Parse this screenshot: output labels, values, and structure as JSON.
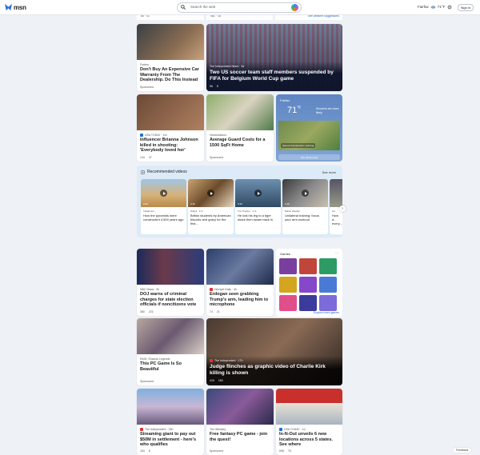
{
  "header": {
    "brand": "msn",
    "search_placeholder": "Search the web",
    "weather": {
      "location": "Fairfax",
      "temp": "71°F"
    },
    "signin_label": "Sign in",
    "feedback_label": "Feedback"
  },
  "top_strip": {
    "meta1": "80   ·   41",
    "meta2": "461   ·   18",
    "link": "See weather suggestions"
  },
  "cards": [
    {
      "id": "forbes",
      "source": "Forbes",
      "title": "Don't Buy An Expensive Car Warranty From The Dealership. Do This Instead",
      "sponsored": "Sponsored"
    },
    {
      "id": "soccer",
      "source": "The Independent News · 3d",
      "title": "Two US soccer team staff members suspended by FIFA for Belgium World Cup game",
      "likes": "96",
      "comments": "8"
    },
    {
      "id": "brianna",
      "source": "USA TODAY · 1hr",
      "title": "Influencer Brianna Johnson killed in shooting: 'Everybody loved her'",
      "likes": "144",
      "comments": "37"
    },
    {
      "id": "guard",
      "source": "HomeAdvisor",
      "title": "Average Guard Costs for a 1500 SqFt Home",
      "sponsored": "Sponsored"
    },
    {
      "id": "doj",
      "source": "NBC News · 9h",
      "title": "DOJ warns of criminal charges for state election officials if noncitizens vote",
      "likes": "380",
      "comments": "222"
    },
    {
      "id": "erdogan",
      "source": "Hürriyet Daily · 4h",
      "title": "Erdogan seen grabbing Trump's arm, leading him to microphone",
      "likes": "74",
      "comments": "21"
    },
    {
      "id": "beautiful",
      "source": "RAID: Shadow Legends",
      "title": "This PC Game Is So Beautiful",
      "sponsored": "Sponsored"
    },
    {
      "id": "judge",
      "source": "The Independent · 17h",
      "title": "Judge flinches as graphic video of Charlie Kirk killing is shown",
      "likes": "419",
      "comments": "180"
    },
    {
      "id": "streaming",
      "source": "The Independent · 23h",
      "title": "Streaming giant to pay out $50M in settlement - here's who qualifies",
      "likes": "184",
      "comments": "8"
    },
    {
      "id": "fantasy",
      "source": "The Whiskey",
      "title": "Free fantasy PC game - join the quest!",
      "sponsored": "Sponsored"
    },
    {
      "id": "innout",
      "source": "USA TODAY · 1d",
      "title": "In-N-Out unveils 6 new locations across 5 states. See where",
      "likes": "698",
      "comments": "76"
    }
  ],
  "weather_card": {
    "location": "Fairfax",
    "temp": "71",
    "unit": "°F",
    "condition": "Showers are more likely",
    "alert": "Severe thunderstorm warning",
    "forecast": "See full forecast"
  },
  "recommended": {
    "title": "Recommended videos",
    "see_more": "See more",
    "videos": [
      {
        "source": "Indiatimes",
        "duration": "0:46",
        "title": "How the pyramids were constructed 4,500 years ago"
      },
      {
        "source": "Daily3 · 1 hr",
        "duration": "0:16",
        "title": "British students try American biscuits and gravy for the first..."
      },
      {
        "source": "Fox Tracker · 1 hr",
        "duration": "0:33",
        "title": "He lost his leg to a tiger shark then swam back in"
      },
      {
        "source": "Maine Weekly",
        "duration": "1:45",
        "title": "Unilateral training: focus your arm workout"
      },
      {
        "source": "G1",
        "duration": "",
        "title": "How a... every..."
      }
    ]
  },
  "games": {
    "title": "Games",
    "explore": "Explore more games",
    "colors": [
      "#7a3f9e",
      "#c0463b",
      "#2c9c64",
      "#d4a51f",
      "#8548c9",
      "#4b79d6",
      "#e04f8c",
      "#3b3b9c",
      "#7c6bd9"
    ]
  }
}
